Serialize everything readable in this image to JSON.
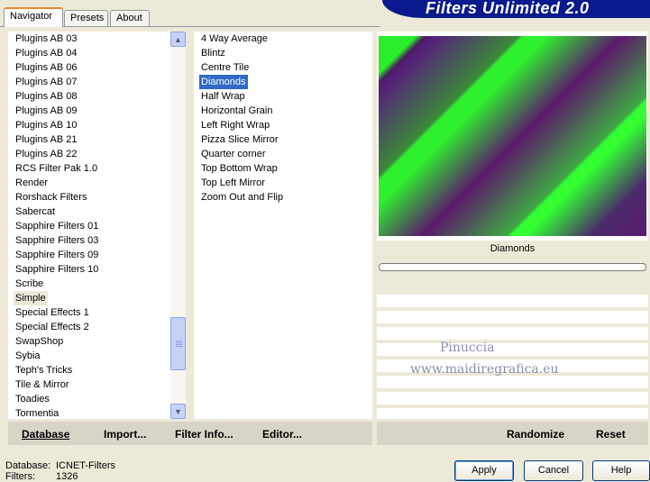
{
  "tabs": [
    {
      "label": "Navigator"
    },
    {
      "label": "Presets"
    },
    {
      "label": "About"
    }
  ],
  "banner": {
    "title": "Filters Unlimited 2.0"
  },
  "categories": {
    "items": [
      "Plugins AB 03",
      "Plugins AB 04",
      "Plugins AB 06",
      "Plugins AB 07",
      "Plugins AB 08",
      "Plugins AB 09",
      "Plugins AB 10",
      "Plugins AB 21",
      "Plugins AB 22",
      "RCS Filter Pak 1.0",
      "Render",
      "Rorshack Filters",
      "Sabercat",
      "Sapphire Filters 01",
      "Sapphire Filters 03",
      "Sapphire Filters 09",
      "Sapphire Filters 10",
      "Scribe",
      "Simple",
      "Special Effects 1",
      "Special Effects 2",
      "SwapShop",
      "Sybia",
      "Teph's Tricks",
      "Tile & Mirror",
      "Toadies",
      "Tormentia"
    ],
    "highlighted": "Simple"
  },
  "filters": {
    "items": [
      "4 Way Average",
      "Blintz",
      "Centre Tile",
      "Diamonds",
      "Half Wrap",
      "Horizontal Grain",
      "Left Right Wrap",
      "Pizza Slice Mirror",
      "Quarter corner",
      "Top Bottom Wrap",
      "Top Left Mirror",
      "Zoom Out and Flip"
    ],
    "selected": "Diamonds"
  },
  "toolbar": {
    "database": "Database",
    "import": "Import...",
    "filter_info": "Filter Info...",
    "editor": "Editor...",
    "randomize": "Randomize",
    "reset": "Reset"
  },
  "preview": {
    "caption": "Diamonds",
    "watermark_line1": "Pinuccia",
    "watermark_line2": "www.maidiregrafica.eu"
  },
  "status": {
    "database_label": "Database:",
    "database_value": "ICNET-Filters",
    "filters_label": "Filters:",
    "filters_value": "1326"
  },
  "buttons": {
    "apply": "Apply",
    "cancel": "Cancel",
    "help": "Help"
  },
  "colors": {
    "selection": "#316ac5",
    "banner": "#0a1a8c",
    "preview_green": "#33ff33",
    "preview_purple": "#5a1a70"
  }
}
